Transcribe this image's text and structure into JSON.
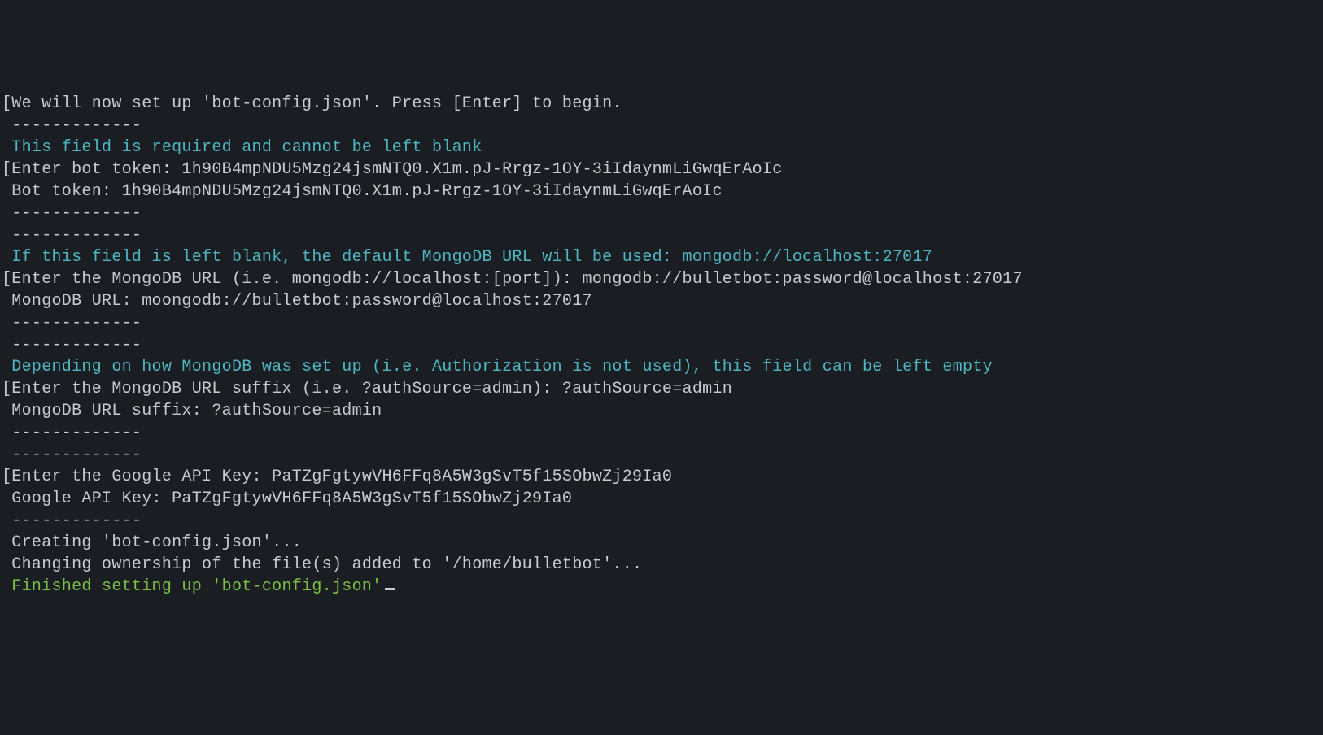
{
  "lines": [
    {
      "text": "[We will now set up 'bot-config.json'. Press [Enter] to begin.",
      "type": "normal"
    },
    {
      "text": "",
      "type": "normal"
    },
    {
      "text": " -------------",
      "type": "normal"
    },
    {
      "text": " This field is required and cannot be left blank",
      "type": "cyan"
    },
    {
      "text": "[Enter bot token: 1h90B4mpNDU5Mzg24jsmNTQ0.X1m.pJ-Rrgz-1OY-3iIdaynmLiGwqErAoIc",
      "type": "normal"
    },
    {
      "text": " Bot token: 1h90B4mpNDU5Mzg24jsmNTQ0.X1m.pJ-Rrgz-1OY-3iIdaynmLiGwqErAoIc",
      "type": "normal"
    },
    {
      "text": " -------------",
      "type": "normal"
    },
    {
      "text": "",
      "type": "normal"
    },
    {
      "text": " -------------",
      "type": "normal"
    },
    {
      "text": " If this field is left blank, the default MongoDB URL will be used: mongodb://localhost:27017",
      "type": "cyan"
    },
    {
      "text": "[Enter the MongoDB URL (i.e. mongodb://localhost:[port]): mongodb://bulletbot:password@localhost:27017",
      "type": "normal"
    },
    {
      "text": "",
      "type": "normal"
    },
    {
      "text": " MongoDB URL: moongodb://bulletbot:password@localhost:27017",
      "type": "normal"
    },
    {
      "text": " -------------",
      "type": "normal"
    },
    {
      "text": "",
      "type": "normal"
    },
    {
      "text": " -------------",
      "type": "normal"
    },
    {
      "text": " Depending on how MongoDB was set up (i.e. Authorization is not used), this field can be left empty",
      "type": "cyan"
    },
    {
      "text": "[Enter the MongoDB URL suffix (i.e. ?authSource=admin): ?authSource=admin",
      "type": "normal"
    },
    {
      "text": " MongoDB URL suffix: ?authSource=admin",
      "type": "normal"
    },
    {
      "text": " -------------",
      "type": "normal"
    },
    {
      "text": "",
      "type": "normal"
    },
    {
      "text": " -------------",
      "type": "normal"
    },
    {
      "text": "[Enter the Google API Key: PaTZgFgtywVH6FFq8A5W3gSvT5f15SObwZj29Ia0",
      "type": "normal"
    },
    {
      "text": " Google API Key: PaTZgFgtywVH6FFq8A5W3gSvT5f15SObwZj29Ia0",
      "type": "normal"
    },
    {
      "text": " -------------",
      "type": "normal"
    },
    {
      "text": "",
      "type": "normal"
    },
    {
      "text": " Creating 'bot-config.json'...",
      "type": "normal"
    },
    {
      "text": " Changing ownership of the file(s) added to '/home/bulletbot'...",
      "type": "normal"
    },
    {
      "text": "",
      "type": "normal"
    },
    {
      "text": " Finished setting up 'bot-config.json'",
      "type": "green",
      "cursor": true
    }
  ]
}
